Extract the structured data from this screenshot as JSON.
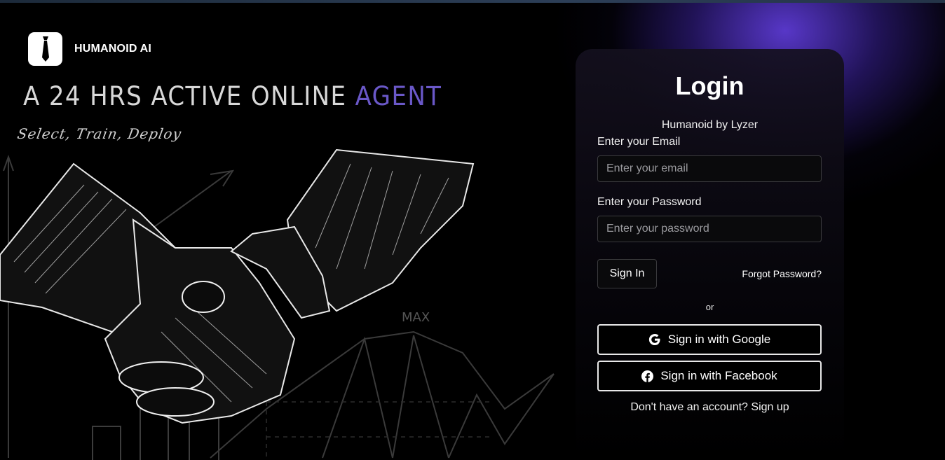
{
  "brand": {
    "name": "HUMANOID AI"
  },
  "hero": {
    "headline_main": "A 24 HRS ACTIVE ONLINE ",
    "headline_accent": "AGENT",
    "tagline": "Select,  Train,  Deploy",
    "chart_label": "MAX"
  },
  "login": {
    "title": "Login",
    "subtitle": "Humanoid by Lyzer",
    "email_label": "Enter your Email",
    "email_placeholder": "Enter your email",
    "email_value": "",
    "password_label": "Enter your Password",
    "password_placeholder": "Enter your password",
    "password_value": "",
    "sign_in_label": "Sign In",
    "forgot_label": "Forgot Password?",
    "or_label": "or",
    "google_label": "Sign in with Google",
    "facebook_label": "Sign in with Facebook",
    "signup_label": "Don't have an account? Sign up"
  },
  "colors": {
    "accent": "#6a58c8",
    "glow": "#5c3ad2",
    "background": "#000000"
  },
  "icons": {
    "logo": "tie-icon",
    "google": "google-icon",
    "facebook": "facebook-icon"
  }
}
